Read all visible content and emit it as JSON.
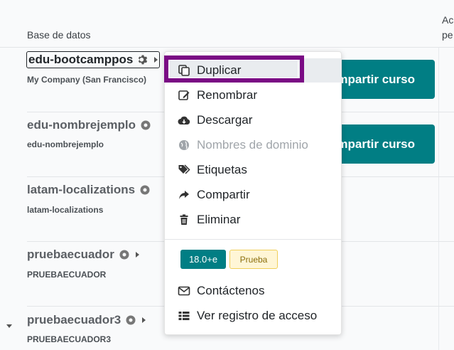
{
  "table": {
    "header_database": "Base de datos",
    "header_right_line1": "Ac",
    "header_right_line2": "pe",
    "share_label": "Compartir curso",
    "rows": [
      {
        "name": "edu-bootcamppos",
        "subtitle": "My Company (San Francisco)"
      },
      {
        "name": "edu-nombrejemplo",
        "subtitle": "edu-nombrejemplo"
      },
      {
        "name": "latam-localizations",
        "subtitle": "latam-localizations"
      },
      {
        "name": "pruebaecuador",
        "subtitle": "PRUEBAECUADOR"
      },
      {
        "name": "pruebaecuador3",
        "subtitle": "PRUEBAECUADOR3"
      }
    ]
  },
  "menu": {
    "items": [
      {
        "label": "Duplicar",
        "icon": "copy-icon"
      },
      {
        "label": "Renombrar",
        "icon": "edit-icon"
      },
      {
        "label": "Descargar",
        "icon": "cloud-download-icon"
      },
      {
        "label": "Nombres de dominio",
        "icon": "globe-icon"
      },
      {
        "label": "Etiquetas",
        "icon": "tags-icon"
      },
      {
        "label": "Compartir",
        "icon": "share-icon"
      },
      {
        "label": "Eliminar",
        "icon": "trash-icon"
      }
    ],
    "version_badge": "18.0+e",
    "environment_badge": "Prueba",
    "contact_label": "Contáctenos",
    "access_log_label": "Ver registro de acceso"
  },
  "colors": {
    "accent": "#017e84",
    "highlight": "#7a0b84"
  }
}
